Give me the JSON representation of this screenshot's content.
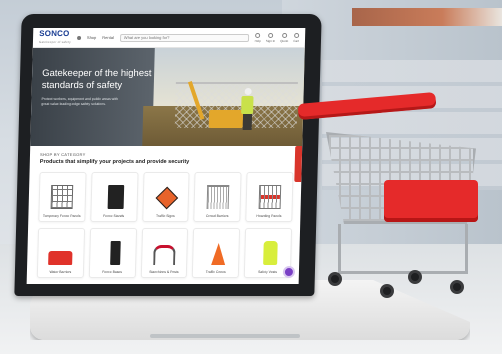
{
  "site": {
    "logo": "SONCO",
    "logo_sub": "Gatekeeper of safety",
    "nav": [
      "Shop",
      "Rental"
    ],
    "search_placeholder": "What are you looking for?",
    "header_icons": [
      "Help",
      "Sign In",
      "Quote",
      "Cart"
    ]
  },
  "hero": {
    "title": "Gatekeeper of the highest standards of safety",
    "description": "Protect workers, equipment and public areas with great value leading-edge safety solutions."
  },
  "categories": {
    "eyebrow": "SHOP BY CATEGORY",
    "heading": "Products that simplify your projects and provide security",
    "items": [
      {
        "label": "Temporary Fence Panels",
        "icon": "fence-panel-icon"
      },
      {
        "label": "Fence Stands",
        "icon": "fence-stand-icon"
      },
      {
        "label": "Traffic Signs",
        "icon": "traffic-sign-icon"
      },
      {
        "label": "Crowd Barriers",
        "icon": "crowd-barrier-icon"
      },
      {
        "label": "Hoarding Panels",
        "icon": "hoarding-panel-icon"
      },
      {
        "label": "Water Barriers",
        "icon": "water-barrier-icon"
      },
      {
        "label": "Fence Bases",
        "icon": "fence-base-icon"
      },
      {
        "label": "Stanchions & Posts",
        "icon": "stanchion-icon"
      },
      {
        "label": "Traffic Cones",
        "icon": "traffic-cone-icon"
      },
      {
        "label": "Safety Vests",
        "icon": "safety-vest-icon"
      }
    ]
  },
  "colors": {
    "brand": "#1c3f94",
    "accent_red": "#e52a2a",
    "chat": "#7a3fc5"
  }
}
